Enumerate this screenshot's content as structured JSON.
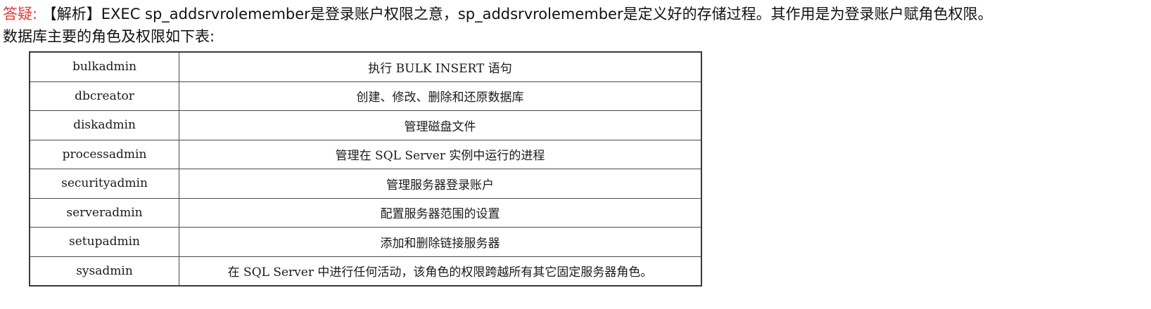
{
  "answer": {
    "label": "答疑:",
    "line1": "【解析】EXEC sp_addsrvrolemember是登录账户权限之意，sp_addsrvrolemember是定义好的存储过程。其作用是为登录账户赋角色权限。",
    "line2": "数据库主要的角色及权限如下表:"
  },
  "table": {
    "rows": [
      {
        "role": "bulkadmin",
        "permission": "执行 BULK INSERT 语句"
      },
      {
        "role": "dbcreator",
        "permission": "创建、修改、删除和还原数据库"
      },
      {
        "role": "diskadmin",
        "permission": "管理磁盘文件"
      },
      {
        "role": "processadmin",
        "permission": "管理在 SQL Server 实例中运行的进程"
      },
      {
        "role": "securityadmin",
        "permission": "管理服务器登录账户"
      },
      {
        "role": "serveradmin",
        "permission": "配置服务器范围的设置"
      },
      {
        "role": "setupadmin",
        "permission": "添加和删除链接服务器"
      },
      {
        "role": "sysadmin",
        "permission": "在 SQL Server 中进行任何活动，该角色的权限跨越所有其它固定服务器角色。"
      }
    ]
  },
  "colors": {
    "label": "#e53935",
    "text": "#111111",
    "border": "#3a3a3a"
  }
}
